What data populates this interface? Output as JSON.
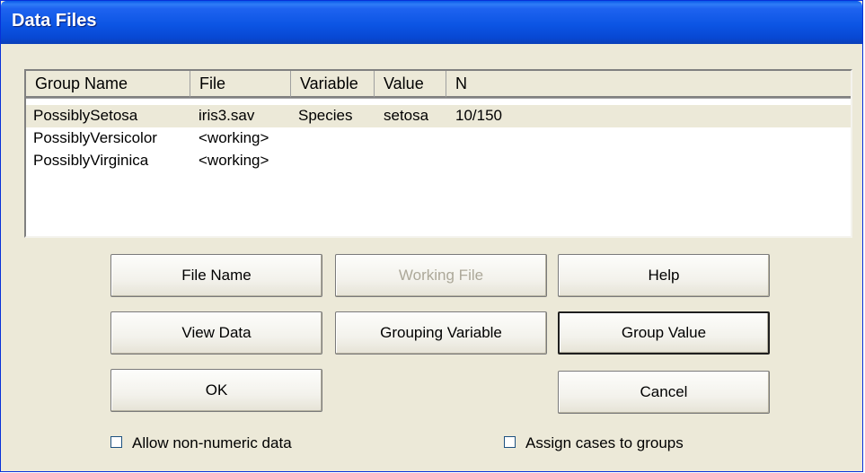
{
  "window": {
    "title": "Data Files"
  },
  "list": {
    "columns": [
      "Group Name",
      "File",
      "Variable",
      "Value",
      "N"
    ],
    "rows": [
      {
        "group": "PossiblySetosa",
        "file": "iris3.sav",
        "variable": "Species",
        "value": "setosa",
        "n": "10/150",
        "selected": true
      },
      {
        "group": "PossiblyVersicolor",
        "file": "<working>",
        "variable": "",
        "value": "",
        "n": "",
        "selected": false
      },
      {
        "group": "PossiblyVirginica",
        "file": "<working>",
        "variable": "",
        "value": "",
        "n": "",
        "selected": false
      }
    ]
  },
  "buttons": {
    "file_name": "File Name",
    "working_file": "Working File",
    "help": "Help",
    "view_data": "View Data",
    "grouping_variable": "Grouping Variable",
    "group_value": "Group Value",
    "ok": "OK",
    "cancel": "Cancel"
  },
  "checkboxes": {
    "allow_non_numeric": {
      "label": "Allow non-numeric data",
      "checked": false
    },
    "assign_cases": {
      "label": "Assign cases to groups",
      "checked": false
    }
  }
}
